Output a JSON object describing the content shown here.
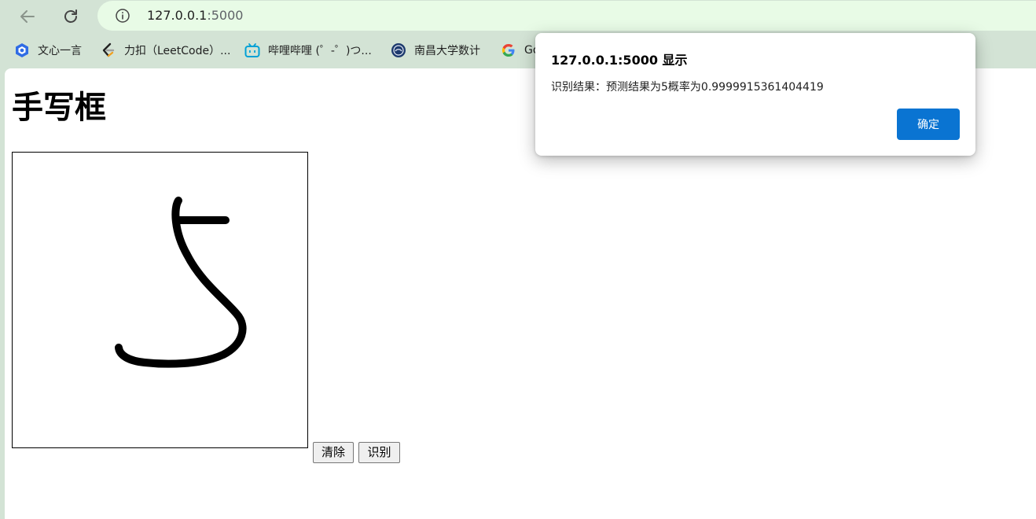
{
  "browser": {
    "url_host": "127.0.0.1",
    "url_port": ":5000",
    "bookmarks": [
      {
        "label": "文心一言",
        "icon": "wenxin-icon"
      },
      {
        "label": "力扣（LeetCode）...",
        "icon": "leetcode-icon"
      },
      {
        "label": "哔哩哔哩 (゜-゜)つ...",
        "icon": "bilibili-icon"
      },
      {
        "label": "南昌大学数计",
        "icon": "university-icon"
      },
      {
        "label": "Go",
        "icon": "google-icon"
      }
    ]
  },
  "page": {
    "title": "手写框",
    "clear_label": "清除",
    "recognize_label": "识别"
  },
  "dialog": {
    "title": "127.0.0.1:5000 显示",
    "message": "识别结果：预测结果为5概率为0.9999915361404419",
    "ok_label": "确定"
  },
  "colors": {
    "accent": "#0a74d2",
    "toolbar": "#d3e3d5",
    "omnibox": "#e8fbe6"
  }
}
